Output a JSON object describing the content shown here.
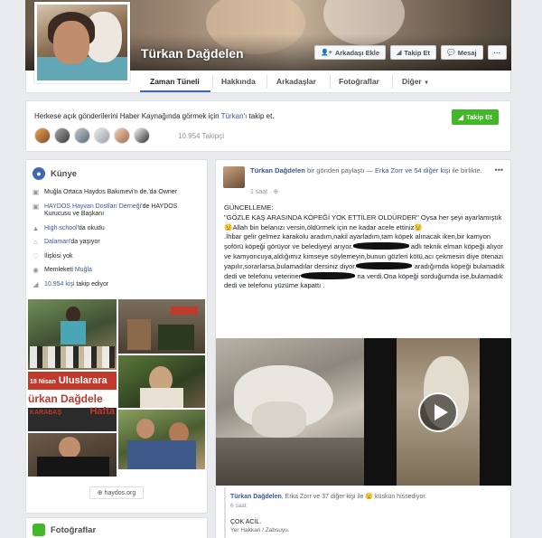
{
  "profile": {
    "name": "Türkan Dağdelen"
  },
  "cover_buttons": {
    "add_friend": "Arkadaşı Ekle",
    "follow": "Takip Et",
    "message": "Mesaj",
    "more": "···"
  },
  "nav": {
    "tabs": [
      "Zaman Tüneli",
      "Hakkında",
      "Arkadaşlar",
      "Fotoğraflar",
      "Diğer"
    ]
  },
  "follow_card": {
    "text_before": "Herkese açık gönderilerini Haber Kaynağında görmek için ",
    "text_link": "Türkan'ı",
    "text_after": " takip et.",
    "button": "Takip Et",
    "followers": "10.954 Takipçi"
  },
  "kunye": {
    "title": "Künye",
    "rows": [
      {
        "icon": "briefcase-icon",
        "text": "Muğla Ortaca Haydos Bakımevi'n de.'da Owner"
      },
      {
        "icon": "briefcase-icon",
        "text_link": "HAYDOS Hayvan Dostları Derneği",
        "text": "'de HAYDOS Kurucusu ve Başkanı"
      },
      {
        "icon": "school-icon",
        "text_link": "High school",
        "text": "'da okudu"
      },
      {
        "icon": "home-icon",
        "text_link": "Dalaman",
        "text": "'da yaşıyor"
      },
      {
        "icon": "heart-icon",
        "text": "İlişkisi yok"
      },
      {
        "icon": "pin-icon",
        "text": "Memleketi ",
        "text_link": "Muğla"
      },
      {
        "icon": "rss-icon",
        "text_link": "10.954 kişi",
        "text": " takip ediyor"
      }
    ],
    "website": "haydos.org"
  },
  "photo_banner": {
    "line1": "18 Nisan",
    "line2": "Uluslarara",
    "line3": "ürkan Dağdele",
    "line4": "KARABAŞ",
    "line5": "Hafta"
  },
  "fotograflar": {
    "title": "Fotoğraflar"
  },
  "post": {
    "author": "Türkan Dağdelen",
    "action": " bir gönderi paylaştı — ",
    "with": "Erka Zorr ve 54 diğer kişi",
    "with_suffix": " ile birlikte.",
    "time": "1 saat",
    "line1": "GÜNCELLEME:",
    "line2": "\"GÖZLE KAŞ ARASINDA KÖPEĞİ YOK ETTİLER OLDÜRDER\" Oysa her şeyi ayarlamıştık😟Allah bin belanızı versin,öldürmek için ne kadar acele ettiniz😟",
    "line3": ".İhbar gelir gelmez karakolu aradım,nakil ayarladım,tam köpek alınacak iken,bir kamyon şoförü köpeği görüyor ve belediyeyi arıyor.",
    "line3b": " adlı teknik elman köpeği alıyor ve kamyoncuya,aldığımız kimseye söylemeyin,bunun gözleri kötü,acı çekmesin diye ötenazi yapılır,sorarlarsa,bulamadılar dersiniz diyor.",
    "line3c": " aradığımda köpeği bulamadık dedi ve telefonu veteriner",
    "line3d": " na verdi.Ona köpeği sorduğumda ise,bulamadık dedi ve telefonu yüzüme kapattı .",
    "reactions_names": "Türkan Dağdelen",
    "reactions_rest": ", Erka Zorr ve 37 diğer kişi ile ",
    "reactions_feeling": "😟 küskün hissediyor.",
    "reactions_time": "6 saat",
    "shared_title": "ÇOK ACİL.",
    "shared_sub": "Yer Hakkari / Zabsuyu."
  },
  "colors": {
    "link": "#385898",
    "green": "#42b72a",
    "bg": "#e9ebee"
  }
}
